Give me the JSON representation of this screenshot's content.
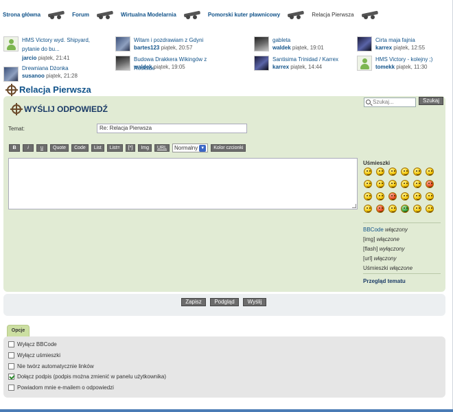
{
  "breadcrumb": {
    "items": [
      "Strona główna",
      "Forum",
      "Wirtualna Modelarnia",
      "Pomorski kuter pławnicowy"
    ],
    "current": "Relacja Pierwsza"
  },
  "recent_topics": [
    {
      "title": "HMS Victory wyd. Shipyard, pytanie do bu...",
      "author": "jarcio",
      "time": "piątek, 21:41",
      "avatar": "user"
    },
    {
      "title": "Witam i pozdrawiam z Gdyni",
      "author": "bartes123",
      "time": "piątek, 20:57",
      "avatar": "photo"
    },
    {
      "title": "gableta",
      "author": "waldek",
      "time": "piątek, 19:01",
      "avatar": "photo2"
    },
    {
      "title": "Cirta maja fajnia",
      "author": "karrex",
      "time": "piątek, 12:55",
      "avatar": "photo3"
    },
    {
      "title": "Drewniana Dżonka",
      "author": "susanoo",
      "time": "piątek, 21:28",
      "avatar": "photo"
    },
    {
      "title": "Budowa Drakkera Wikingów z Roskilde",
      "author": "waldek",
      "time": "piątek, 19:05",
      "avatar": "photo2"
    },
    {
      "title": "Santisima Trinidad / Karrex",
      "author": "karrex",
      "time": "piątek, 14:44",
      "avatar": "photo3"
    },
    {
      "title": "HMS Victory - kolejny ;)",
      "author": "tomekk",
      "time": "piątek, 11:30",
      "avatar": "user"
    }
  ],
  "topic_title": "Relacja Pierwsza",
  "search": {
    "placeholder": "Szukaj...",
    "button": "Szukaj"
  },
  "post": {
    "heading": "WYŚLIJ ODPOWIEDŹ",
    "subject_label": "Temat:",
    "subject_value": "Re: Relacja Pierwsza",
    "toolbar": [
      "B",
      "i",
      "u",
      "Quote",
      "Code",
      "List",
      "List=",
      "[*]",
      "Img",
      "URL"
    ],
    "font_size": "Normalny",
    "font_color_button": "Kolor czcionki",
    "message": ""
  },
  "smilies": {
    "heading": "Uśmieszki",
    "icons": [
      "very-happy",
      "smile",
      "wink",
      "sad",
      "surprised",
      "shocked",
      "confused",
      "cool",
      "laughing",
      "mad",
      "razz",
      "evil",
      "embarrassed",
      "crying",
      "twisted-evil",
      "rolling-eyes",
      "exclaim",
      "question",
      "idea",
      "arrow",
      "neutral",
      "mr-green",
      "geek",
      "ugeek"
    ]
  },
  "options_status": [
    {
      "name": "BBCode",
      "state": "włączony",
      "link": true
    },
    {
      "name": "[img]",
      "state": "włączone",
      "link": false
    },
    {
      "name": "[flash]",
      "state": "wyłączony",
      "link": false
    },
    {
      "name": "[url]",
      "state": "włączony",
      "link": false
    },
    {
      "name": "Uśmieszki",
      "state": "włączone",
      "link": false
    }
  ],
  "topic_review": "Przegląd tematu",
  "buttons": {
    "save": "Zapisz",
    "preview": "Podgląd",
    "submit": "Wyślij"
  },
  "options_tab": "Opcje",
  "checkboxes": [
    {
      "label": "Wyłącz BBCode",
      "checked": false
    },
    {
      "label": "Wyłącz uśmieszki",
      "checked": false
    },
    {
      "label": "Nie twórz automatycznie linków",
      "checked": false
    },
    {
      "label": "Dołącz podpis (podpis można zmienić w panelu użytkownika)",
      "checked": true
    },
    {
      "label": "Powiadom mnie e-mailem o odpowiedzi",
      "checked": false
    }
  ],
  "colors": {
    "link": "#105289",
    "panel": "#e1ebd4",
    "options_tab": "#ccdfa2",
    "button": "#6c6c6c"
  }
}
